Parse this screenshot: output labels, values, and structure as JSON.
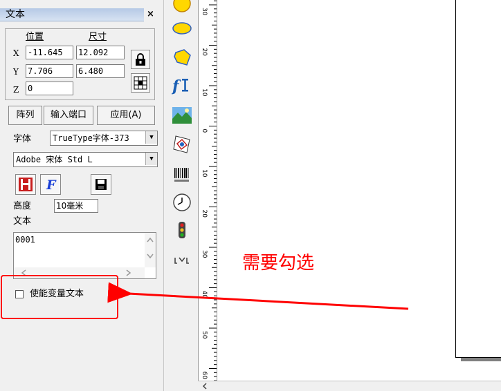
{
  "panel": {
    "title": "文本",
    "close": "×",
    "pos_header": "位置",
    "size_header": "尺寸",
    "x_label": "X",
    "y_label": "Y",
    "z_label": "Z",
    "x_value": "-11.645",
    "y_value": "7.706",
    "z_value": "0",
    "width_value": "12.092",
    "height_value": "6.480",
    "btn_array": "阵列",
    "btn_input_port": "输入端口",
    "btn_apply": "应用(A)",
    "font_label": "字体",
    "font_type": "TrueType字体-373",
    "font_name": "Adobe 宋体 Std L",
    "height_label": "高度",
    "height_field": "10毫米",
    "text_label": "文本",
    "text_content": "0001",
    "checkbox_label": "使能变量文本"
  },
  "ruler": {
    "labels": [
      "30",
      "20",
      "10",
      "0",
      "10",
      "20",
      "30",
      "40",
      "50",
      "60"
    ]
  },
  "annotation": {
    "text": "需要勾选",
    "color": "#ff0000"
  },
  "colors": {
    "highlight": "#ff0000",
    "panel_bg": "#f0f0f0",
    "shape_fill": "#ffd700"
  },
  "tools": [
    "ellipse-icon",
    "polygon-icon",
    "text-tool-icon",
    "bitmap-icon",
    "vector-file-icon",
    "barcode-icon",
    "clock-icon",
    "input-output-icon",
    "timer-icon"
  ]
}
